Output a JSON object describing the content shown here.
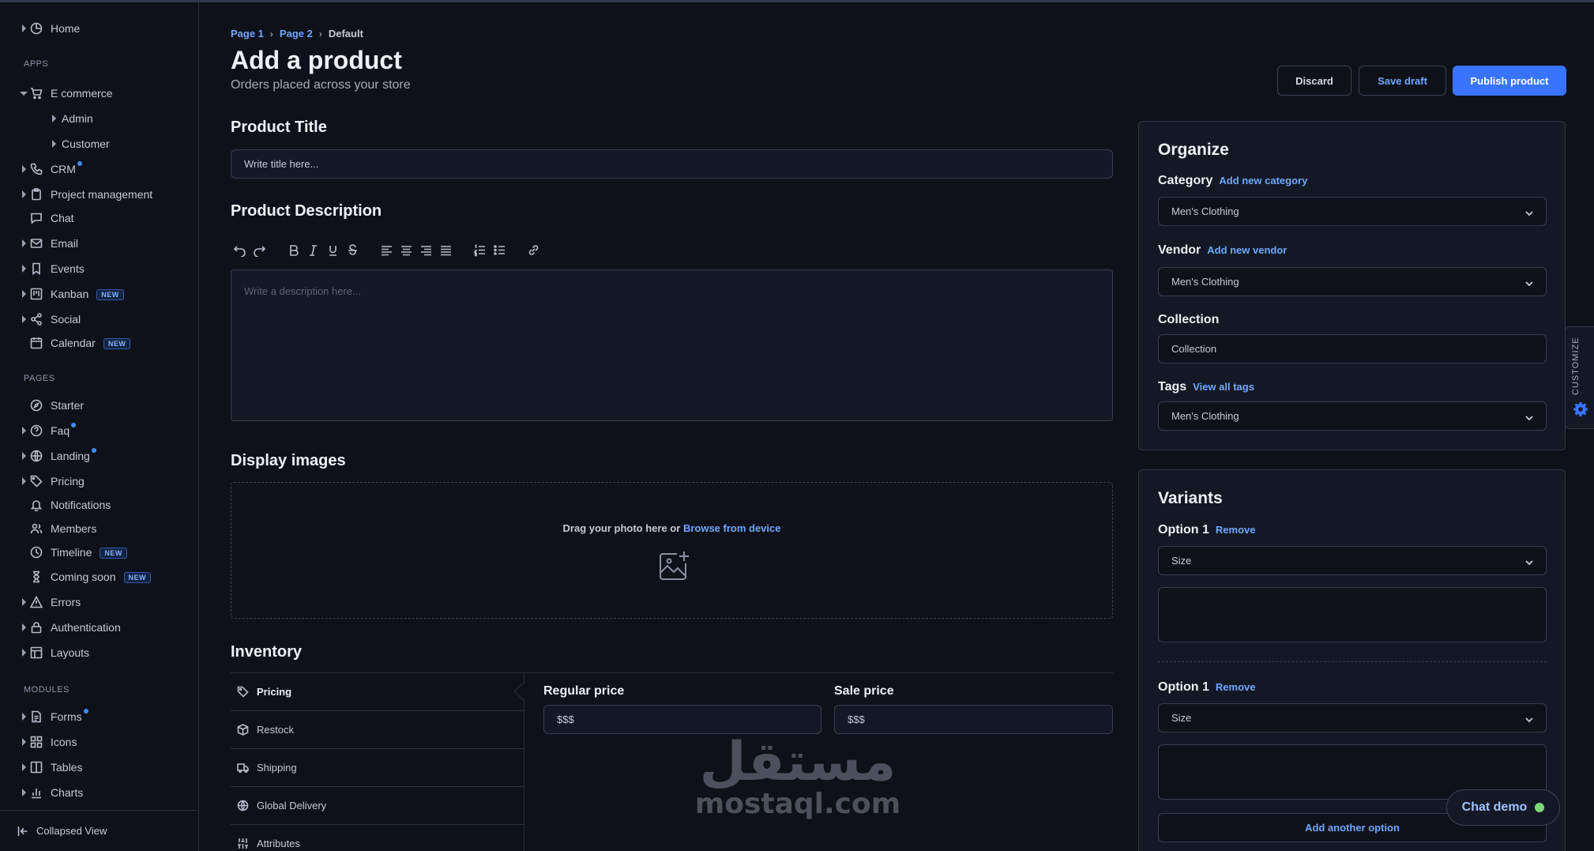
{
  "sidebar": {
    "items": [
      {
        "label": "Home"
      },
      {
        "label": "E commerce"
      },
      {
        "label": "Admin"
      },
      {
        "label": "Customer"
      },
      {
        "label": "CRM"
      },
      {
        "label": "Project management"
      },
      {
        "label": "Chat"
      },
      {
        "label": "Email"
      },
      {
        "label": "Events"
      },
      {
        "label": "Kanban",
        "badge": "NEW"
      },
      {
        "label": "Social"
      },
      {
        "label": "Calendar",
        "badge": "NEW"
      },
      {
        "label": "Starter"
      },
      {
        "label": "Faq"
      },
      {
        "label": "Landing"
      },
      {
        "label": "Pricing"
      },
      {
        "label": "Notifications"
      },
      {
        "label": "Members"
      },
      {
        "label": "Timeline",
        "badge": "NEW"
      },
      {
        "label": "Coming soon",
        "badge": "NEW"
      },
      {
        "label": "Errors"
      },
      {
        "label": "Authentication"
      },
      {
        "label": "Layouts"
      },
      {
        "label": "Forms"
      },
      {
        "label": "Icons"
      },
      {
        "label": "Tables"
      },
      {
        "label": "Charts"
      }
    ],
    "sections": {
      "apps": "APPS",
      "pages": "PAGES",
      "modules": "MODULES"
    },
    "collapsed_label": "Collapsed View"
  },
  "breadcrumb": {
    "page1": "Page 1",
    "page2": "Page 2",
    "current": "Default"
  },
  "header": {
    "title": "Add a product",
    "subtitle": "Orders placed across your store",
    "discard": "Discard",
    "save_draft": "Save draft",
    "publish": "Publish product"
  },
  "product_title": {
    "label": "Product Title",
    "placeholder": "Write title here..."
  },
  "product_description": {
    "label": "Product Description",
    "placeholder": "Write a description here..."
  },
  "display_images": {
    "label": "Display images",
    "drag_text": "Drag your photo here or",
    "browse_link": "Browse from device"
  },
  "inventory": {
    "label": "Inventory",
    "tabs": [
      {
        "label": "Pricing"
      },
      {
        "label": "Restock"
      },
      {
        "label": "Shipping"
      },
      {
        "label": "Global Delivery"
      },
      {
        "label": "Attributes"
      }
    ],
    "regular_price": {
      "label": "Regular price",
      "placeholder": "$$$"
    },
    "sale_price": {
      "label": "Sale price",
      "placeholder": "$$$"
    }
  },
  "organize": {
    "title": "Organize",
    "category": {
      "label": "Category",
      "link": "Add new category",
      "value": "Men's Clothing"
    },
    "vendor": {
      "label": "Vendor",
      "link": "Add new vendor",
      "value": "Men's Clothing"
    },
    "collection": {
      "label": "Collection",
      "placeholder": "Collection"
    },
    "tags": {
      "label": "Tags",
      "link": "View all tags",
      "value": "Men's Clothing"
    }
  },
  "variants": {
    "title": "Variants",
    "options": [
      {
        "label": "Option 1",
        "remove": "Remove",
        "value": "Size"
      },
      {
        "label": "Option 1",
        "remove": "Remove",
        "value": "Size"
      }
    ],
    "add_option": "Add another option"
  },
  "customize": {
    "label": "CUSTOMIZE"
  },
  "chat_demo": {
    "label": "Chat demo"
  },
  "watermark": {
    "arabic": "مستقل",
    "latin": "mostaql.com"
  },
  "colors": {
    "accent": "#3874ff",
    "link": "#6ea8fe",
    "background": "#0f111a",
    "card": "#141824",
    "online": "#7ed67a"
  }
}
